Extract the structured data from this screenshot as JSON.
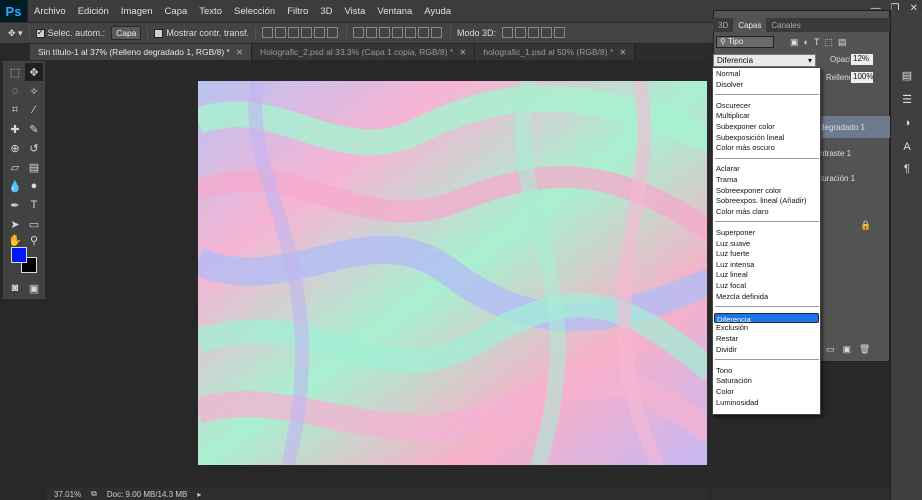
{
  "app": {
    "logo": "Ps"
  },
  "menubar": {
    "items": [
      "Archivo",
      "Edición",
      "Imagen",
      "Capa",
      "Texto",
      "Selección",
      "Filtro",
      "3D",
      "Vista",
      "Ventana",
      "Ayuda"
    ],
    "window_controls": [
      "minimize-icon",
      "restore-icon",
      "close-icon"
    ]
  },
  "options": {
    "auto_select_label": "Selec. autom.:",
    "auto_select_checked": true,
    "auto_select_target": "Capa",
    "show_transform_label": "Mostrar contr. transf.",
    "show_transform_checked": false,
    "mode3d_label": "Modo 3D:"
  },
  "tabs": [
    {
      "label": "Sin título-1 al 37% (Relleno degradado 1, RGB/8) *",
      "active": true
    },
    {
      "label": "Holografic_2.psd al 33.3% (Capa 1 copia, RGB/8) *",
      "active": false
    },
    {
      "label": "holografic_1.psd al 50% (RGB/8) *",
      "active": false
    }
  ],
  "tools": [
    "move-icon",
    "marquee-icon",
    "lasso-icon",
    "magic-wand-icon",
    "eyedropper-icon",
    "crop-icon",
    "healing-icon",
    "brush-icon",
    "clone-icon",
    "history-brush-icon",
    "eraser-icon",
    "gradient-icon",
    "blur-icon",
    "dodge-icon",
    "pen-icon",
    "type-icon",
    "path-select-icon",
    "shape-icon",
    "hand-icon",
    "zoom-icon"
  ],
  "colors": {
    "foreground": "#0016ff",
    "background": "#000000"
  },
  "status": {
    "zoom": "37.01%",
    "doc": "Doc: 9.00 MB/14.3 MB"
  },
  "panel": {
    "tabs": [
      "3D",
      "Capas",
      "Canales"
    ],
    "active_tab": "Capas",
    "kind_filter": "Tipo",
    "blend_mode": "Diferencia",
    "opacity_label": "Opacidad:",
    "opacity_value": "12%",
    "fill_label": "Relleno:",
    "fill_value": "100%",
    "layers": [
      "degradado 1",
      "ntraste 1",
      "turación 1"
    ]
  },
  "blend_groups": [
    [
      "Normal",
      "Disolver"
    ],
    [
      "Oscurecer",
      "Multiplicar",
      "Subexponer color",
      "Subexposición lineal",
      "Color más oscuro"
    ],
    [
      "Aclarar",
      "Trama",
      "Sobreexponer color",
      "Sobreexpos. lineal (Añadir)",
      "Color más claro"
    ],
    [
      "Superponer",
      "Luz suave",
      "Luz fuerte",
      "Luz intensa",
      "Luz lineal",
      "Luz focal",
      "Mezcla definida"
    ],
    [
      "Diferencia",
      "Exclusión",
      "Restar",
      "Dividir"
    ],
    [
      "Tono",
      "Saturación",
      "Color",
      "Luminosidad"
    ]
  ],
  "dock_icons": [
    "history-icon",
    "properties-icon",
    "adjustments-icon",
    "character-icon",
    "paragraph-icon"
  ]
}
